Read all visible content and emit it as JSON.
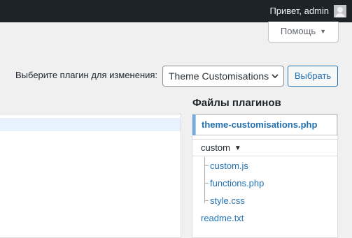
{
  "admin_bar": {
    "greeting": "Привет, admin",
    "avatar_icon": "user-avatar-icon"
  },
  "help": {
    "label": "Помощь",
    "arrow": "▼"
  },
  "plugin_selector": {
    "label": "Выберите плагин для изменения:",
    "selected": "Theme Customisations",
    "button": "Выбрать"
  },
  "files": {
    "title": "Файлы плагинов",
    "current_file": "theme-customisations.php",
    "folder": {
      "name": "custom",
      "caret": "▼",
      "children": [
        "custom.js",
        "functions.php",
        "style.css"
      ]
    },
    "root_files": [
      "readme.txt"
    ]
  },
  "colors": {
    "admin_bar_bg": "#1d2327",
    "link": "#2271b1",
    "active_line": "#e8f2ff",
    "current_file_accent": "#72aee6"
  }
}
